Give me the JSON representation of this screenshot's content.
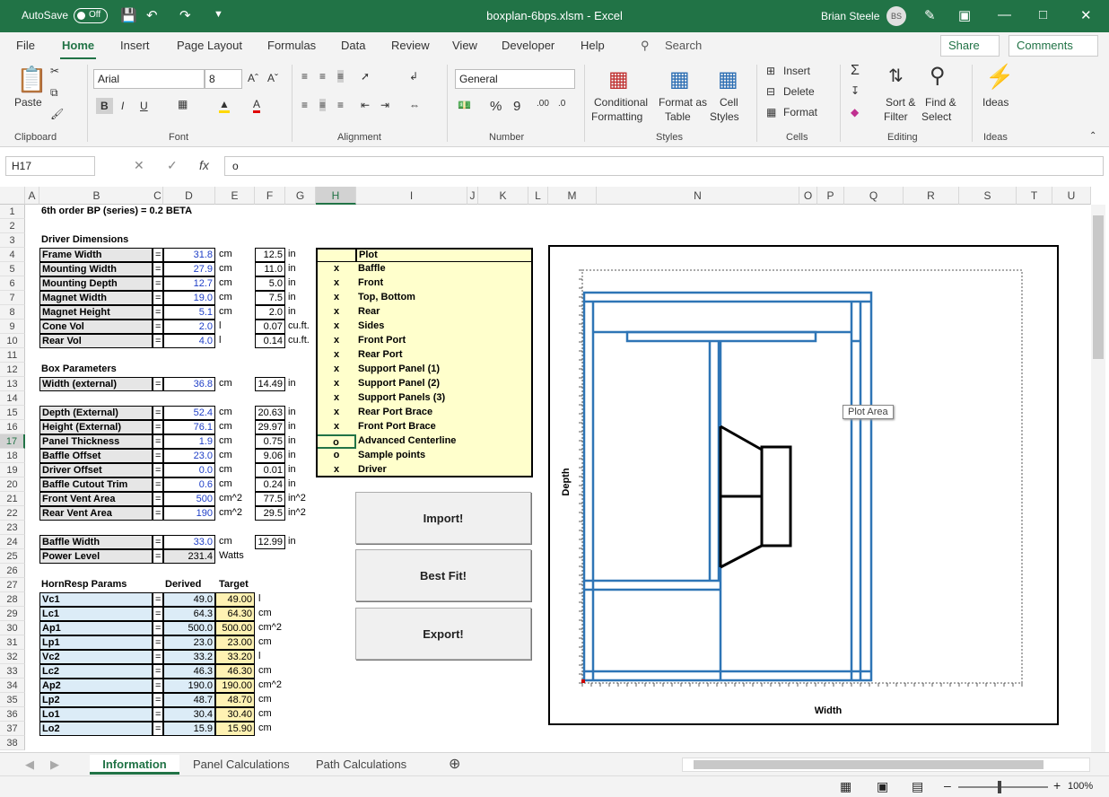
{
  "titlebar": {
    "autosave": "AutoSave",
    "toggle": "Off",
    "document": "boxplan-6bps.xlsm  -  Excel",
    "user": "Brian Steele",
    "initials": "BS"
  },
  "menu": {
    "tabs": [
      "File",
      "Home",
      "Insert",
      "Page Layout",
      "Formulas",
      "Data",
      "Review",
      "View",
      "Developer",
      "Help"
    ],
    "search": "Search",
    "share": "Share",
    "comments": "Comments"
  },
  "ribbon": {
    "clipboard": {
      "paste": "Paste",
      "label": "Clipboard"
    },
    "font": {
      "name": "Arial",
      "size": "8",
      "bold": "B",
      "italic": "I",
      "underline": "U",
      "label": "Font"
    },
    "alignment": {
      "label": "Alignment"
    },
    "number": {
      "format": "General",
      "label": "Number"
    },
    "styles": {
      "cond1": "Conditional",
      "cond2": "Formatting",
      "fmt1": "Format as",
      "fmt2": "Table",
      "cell1": "Cell",
      "cell2": "Styles",
      "label": "Styles"
    },
    "cells": {
      "insert": "Insert",
      "delete": "Delete",
      "format": "Format",
      "label": "Cells"
    },
    "editing": {
      "sort1": "Sort &",
      "sort2": "Filter",
      "find1": "Find &",
      "find2": "Select",
      "label": "Editing"
    },
    "ideas": {
      "btn": "Ideas",
      "label": "Ideas"
    }
  },
  "formula_bar": {
    "name_box": "H17",
    "value": "o",
    "fx": "fx"
  },
  "columns": [
    "A",
    "B",
    "C",
    "D",
    "E",
    "F",
    "G",
    "H",
    "I",
    "J",
    "K",
    "L",
    "M",
    "N",
    "O",
    "P",
    "Q",
    "R",
    "S",
    "T",
    "U"
  ],
  "rows": [
    "1",
    "2",
    "3",
    "4",
    "5",
    "6",
    "7",
    "8",
    "9",
    "10",
    "11",
    "12",
    "13",
    "14",
    "15",
    "16",
    "17",
    "18",
    "19",
    "20",
    "21",
    "22",
    "23",
    "24",
    "25",
    "26",
    "27",
    "28",
    "29",
    "30",
    "31",
    "32",
    "33",
    "34",
    "35",
    "36",
    "37",
    "38"
  ],
  "sheet": {
    "title": "6th order BP (series)   =   0.2 BETA",
    "driver_header": "Driver Dimensions",
    "driver": [
      {
        "label": "Frame Width",
        "eq": "=",
        "val": "31.8",
        "unit": "cm",
        "in": "12.5",
        "inunit": "in"
      },
      {
        "label": "Mounting Width",
        "eq": "=",
        "val": "27.9",
        "unit": "cm",
        "in": "11.0",
        "inunit": "in"
      },
      {
        "label": "Mounting Depth",
        "eq": "=",
        "val": "12.7",
        "unit": "cm",
        "in": "5.0",
        "inunit": "in"
      },
      {
        "label": "Magnet Width",
        "eq": "=",
        "val": "19.0",
        "unit": "cm",
        "in": "7.5",
        "inunit": "in"
      },
      {
        "label": "Magnet Height",
        "eq": "=",
        "val": "5.1",
        "unit": "cm",
        "in": "2.0",
        "inunit": "in"
      },
      {
        "label": "Cone Vol",
        "eq": "=",
        "val": "2.0",
        "unit": "l",
        "in": "0.07",
        "inunit": "cu.ft."
      },
      {
        "label": "Rear Vol",
        "eq": "=",
        "val": "4.0",
        "unit": "l",
        "in": "0.14",
        "inunit": "cu.ft."
      }
    ],
    "box_header": "Box Parameters",
    "width_ext": {
      "label": "Width (external)",
      "eq": "=",
      "val": "36.8",
      "unit": "cm",
      "in": "14.49",
      "inunit": "in"
    },
    "box": [
      {
        "label": "Depth (External)",
        "eq": "=",
        "val": "52.4",
        "unit": "cm",
        "in": "20.63",
        "inunit": "in"
      },
      {
        "label": "Height (External)",
        "eq": "=",
        "val": "76.1",
        "unit": "cm",
        "in": "29.97",
        "inunit": "in"
      },
      {
        "label": "Panel Thickness",
        "eq": "=",
        "val": "1.9",
        "unit": "cm",
        "in": "0.75",
        "inunit": "in"
      },
      {
        "label": "Baffle Offset",
        "eq": "=",
        "val": "23.0",
        "unit": "cm",
        "in": "9.06",
        "inunit": "in"
      },
      {
        "label": "Driver Offset",
        "eq": "=",
        "val": "0.0",
        "unit": "cm",
        "in": "0.01",
        "inunit": "in"
      },
      {
        "label": "Baffle Cutout Trim",
        "eq": "=",
        "val": "0.6",
        "unit": "cm",
        "in": "0.24",
        "inunit": "in"
      },
      {
        "label": "Front Vent Area",
        "eq": "=",
        "val": "500",
        "unit": "cm^2",
        "in": "77.5",
        "inunit": "in^2"
      },
      {
        "label": "Rear Vent Area",
        "eq": "=",
        "val": "190",
        "unit": "cm^2",
        "in": "29.5",
        "inunit": "in^2"
      }
    ],
    "baffle_width": {
      "label": "Baffle Width",
      "eq": "=",
      "val": "33.0",
      "unit": "cm",
      "in": "12.99",
      "inunit": "in"
    },
    "power": {
      "label": "Power Level",
      "eq": "=",
      "val": "231.4",
      "unit": "Watts"
    },
    "hr_header": {
      "title": "HornResp Params",
      "derived": "Derived",
      "target": "Target"
    },
    "hr": [
      {
        "label": "Vc1",
        "eq": "=",
        "derived": "49.0",
        "target": "49.00",
        "unit": "l"
      },
      {
        "label": "Lc1",
        "eq": "=",
        "derived": "64.3",
        "target": "64.30",
        "unit": "cm"
      },
      {
        "label": "Ap1",
        "eq": "=",
        "derived": "500.0",
        "target": "500.00",
        "unit": "cm^2"
      },
      {
        "label": "Lp1",
        "eq": "=",
        "derived": "23.0",
        "target": "23.00",
        "unit": "cm"
      },
      {
        "label": "Vc2",
        "eq": "=",
        "derived": "33.2",
        "target": "33.20",
        "unit": "l"
      },
      {
        "label": "Lc2",
        "eq": "=",
        "derived": "46.3",
        "target": "46.30",
        "unit": "cm"
      },
      {
        "label": "Ap2",
        "eq": "=",
        "derived": "190.0",
        "target": "190.00",
        "unit": "cm^2"
      },
      {
        "label": "Lp2",
        "eq": "=",
        "derived": "48.7",
        "target": "48.70",
        "unit": "cm"
      },
      {
        "label": "Lo1",
        "eq": "=",
        "derived": "30.4",
        "target": "30.40",
        "unit": "cm"
      },
      {
        "label": "Lo2",
        "eq": "=",
        "derived": "15.9",
        "target": "15.90",
        "unit": "cm"
      }
    ],
    "plot_header": "Plot",
    "plot_items": [
      {
        "mark": "x",
        "label": "Baffle"
      },
      {
        "mark": "x",
        "label": "Front"
      },
      {
        "mark": "x",
        "label": "Top, Bottom"
      },
      {
        "mark": "x",
        "label": "Rear"
      },
      {
        "mark": "x",
        "label": "Sides"
      },
      {
        "mark": "x",
        "label": "Front Port"
      },
      {
        "mark": "x",
        "label": "Rear Port"
      },
      {
        "mark": "x",
        "label": "Support Panel (1)"
      },
      {
        "mark": "x",
        "label": "Support Panel (2)"
      },
      {
        "mark": "x",
        "label": "Support Panels (3)"
      },
      {
        "mark": "x",
        "label": "Rear Port Brace"
      },
      {
        "mark": "x",
        "label": "Front Port Brace"
      },
      {
        "mark": "o",
        "label": "Advanced Centerline"
      },
      {
        "mark": "o",
        "label": "Sample points"
      },
      {
        "mark": "x",
        "label": "Driver"
      }
    ],
    "buttons": {
      "import": "Import!",
      "bestfit": "Best Fit!",
      "export": "Export!"
    }
  },
  "chart": {
    "ylabel": "Depth",
    "xlabel": "Width",
    "tooltip": "Plot Area"
  },
  "sheet_tabs": [
    "Information",
    "Panel Calculations",
    "Path Calculations"
  ],
  "status": {
    "zoom": "100%"
  }
}
